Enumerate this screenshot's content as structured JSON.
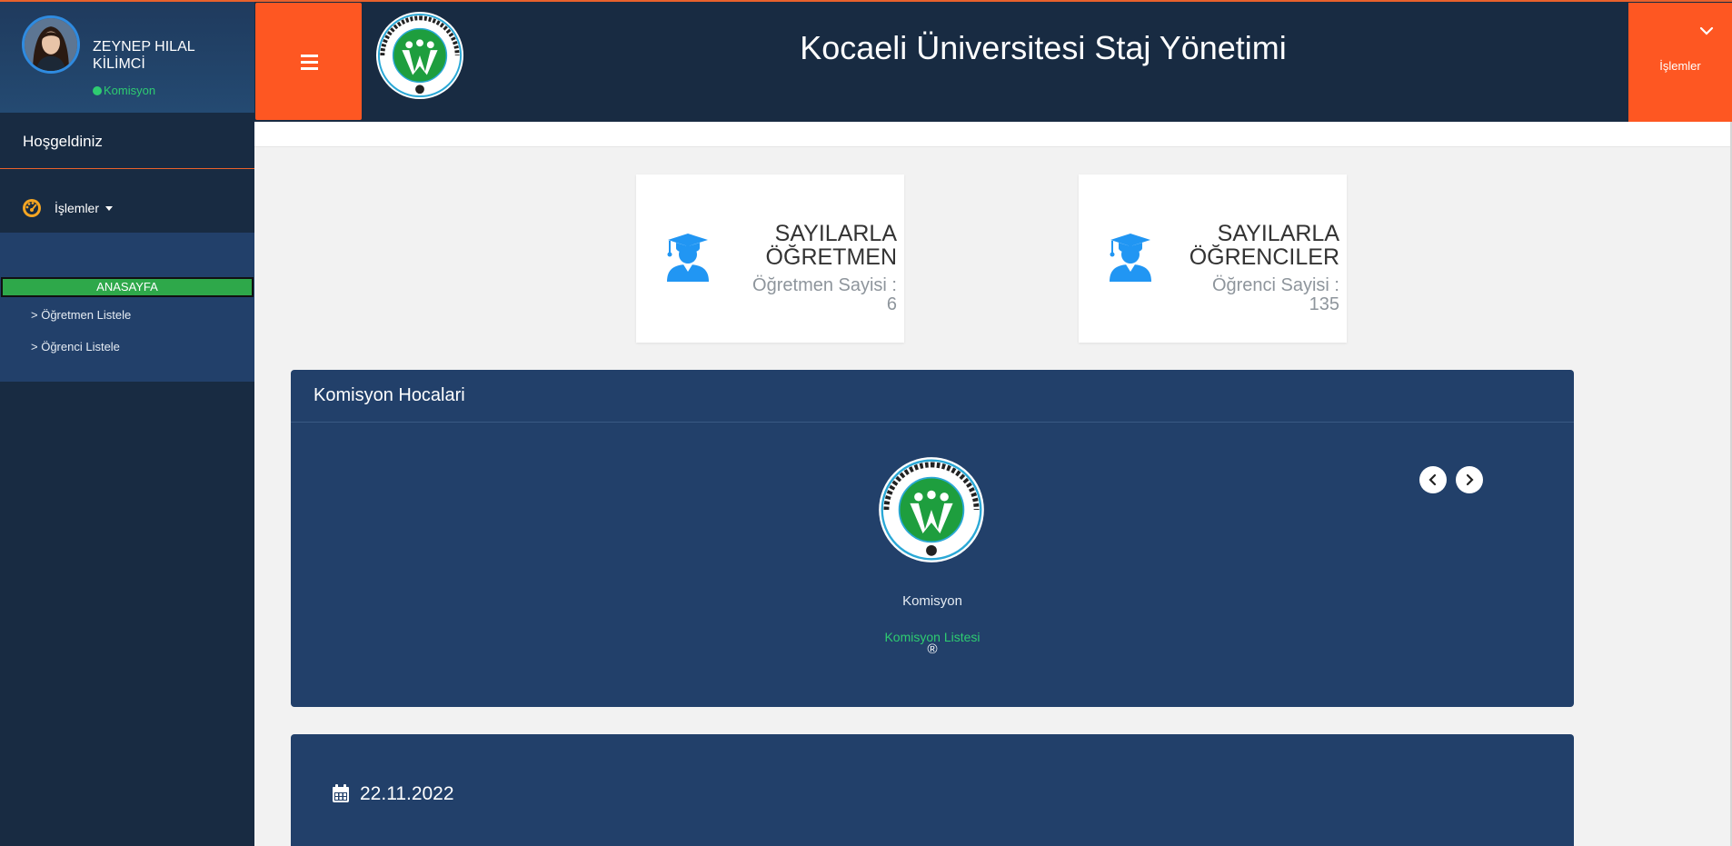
{
  "app": {
    "title": "Kocaeli Üniversitesi Staj Yönetimi"
  },
  "colors": {
    "accent": "#fe5722",
    "sidebar": "#182b42",
    "panel": "#22406a",
    "status_green": "#2ecc71",
    "active_green": "#2ea84a",
    "icon_blue": "#2196f3"
  },
  "user": {
    "name": "ZEYNEP HILAL KİLİMCİ",
    "role": "Komisyon"
  },
  "sidebar": {
    "welcome": "Hoşgeldiniz",
    "menu_label": "İşlemler",
    "active_item": "ANASAYFA",
    "links": [
      {
        "label": "> Öğretmen Listele"
      },
      {
        "label": "> Öğrenci Listele"
      }
    ]
  },
  "header": {
    "actions_label": "İşlemler"
  },
  "stats": [
    {
      "title": "SAYILARLA ÖĞRETMEN",
      "count_text": "Öğretmen Sayisi : 6"
    },
    {
      "title": "SAYILARLA ÖĞRENCILER",
      "count_text": "Öğrenci Sayisi : 135"
    }
  ],
  "commission": {
    "title": "Komisyon Hocalari",
    "member_name": "Komisyon",
    "link_label": "Komisyon Listesi",
    "reg_mark": "®"
  },
  "date_panel": {
    "date": "22.11.2022"
  },
  "icons": {
    "menu": "hamburger-icon",
    "gauge": "gauge-icon",
    "caret": "caret-down-icon",
    "graduate": "graduate-icon",
    "calendar": "calendar-icon",
    "chevron": "chevron-down-icon"
  }
}
